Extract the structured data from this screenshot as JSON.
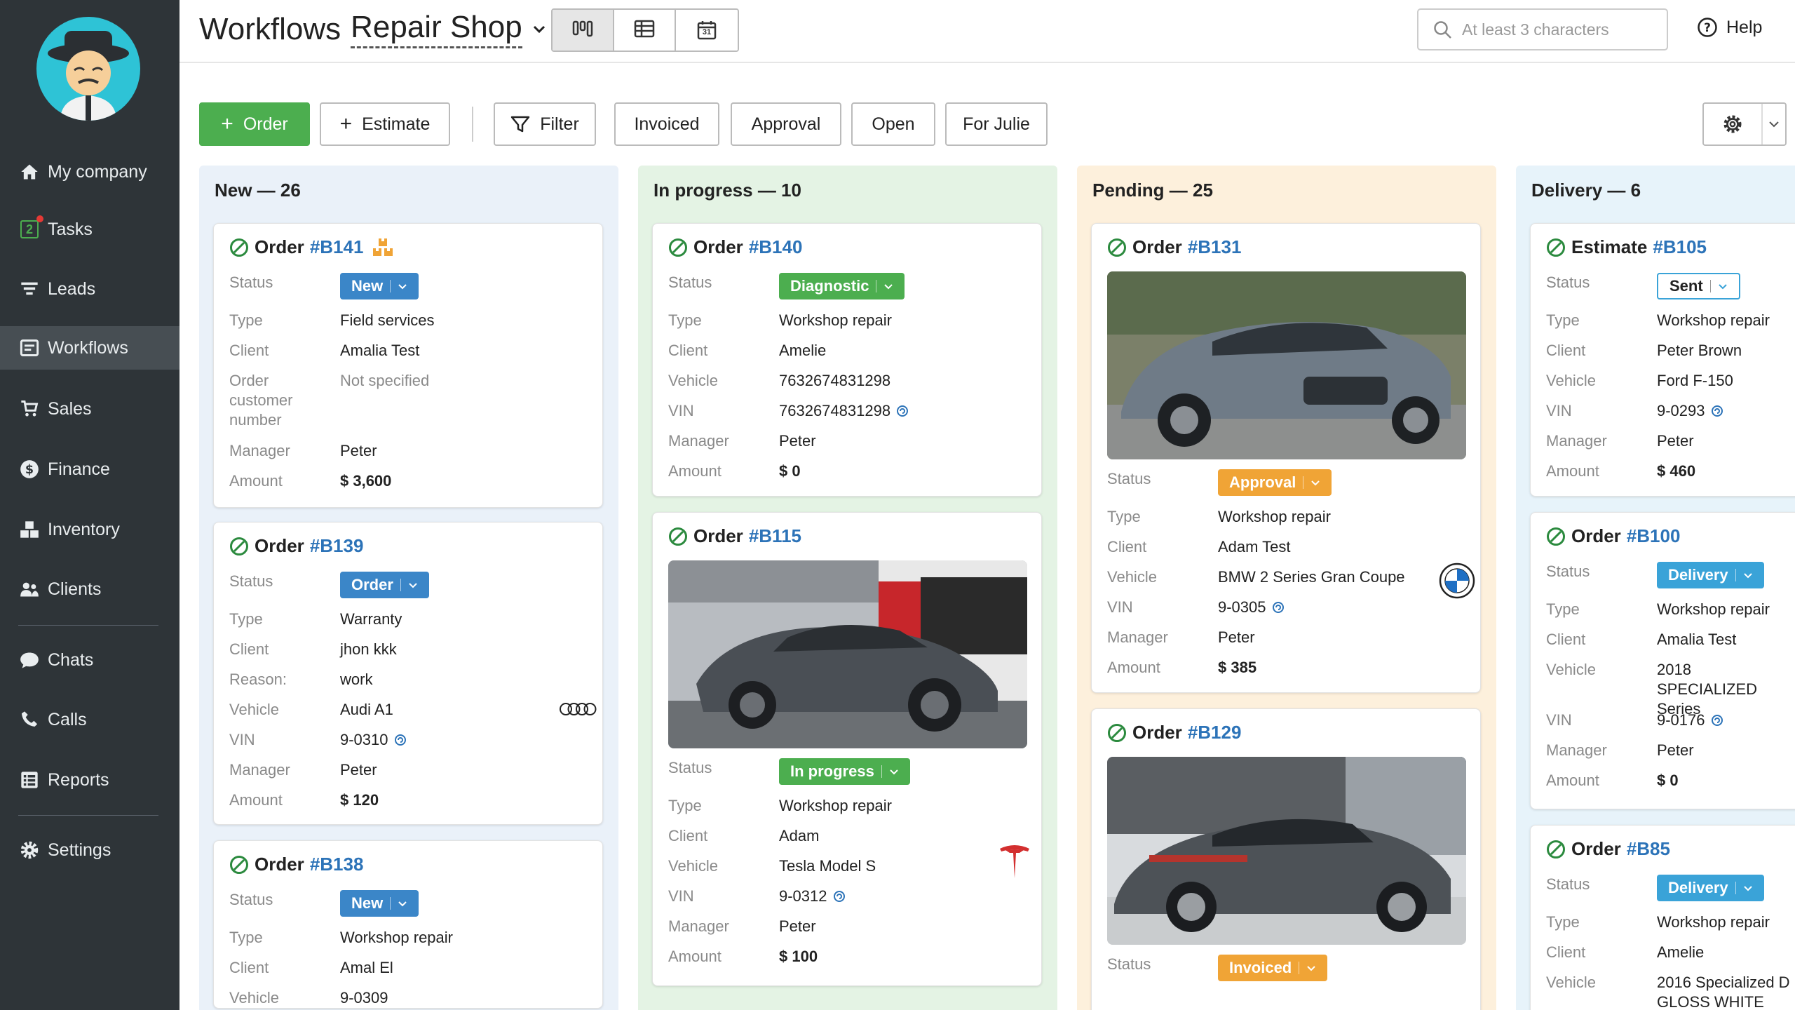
{
  "sidebar": {
    "items": [
      {
        "label": "My company",
        "icon": "home-icon"
      },
      {
        "label": "Tasks",
        "icon": "tasks-icon",
        "badge": "2"
      },
      {
        "label": "Leads",
        "icon": "funnel-icon"
      },
      {
        "label": "Workflows",
        "icon": "workflows-icon"
      },
      {
        "label": "Sales",
        "icon": "cart-icon"
      },
      {
        "label": "Finance",
        "icon": "dollar-icon"
      },
      {
        "label": "Inventory",
        "icon": "boxes-icon"
      },
      {
        "label": "Clients",
        "icon": "users-icon"
      },
      {
        "label": "Chats",
        "icon": "chat-icon"
      },
      {
        "label": "Calls",
        "icon": "phone-icon"
      },
      {
        "label": "Reports",
        "icon": "reports-icon"
      },
      {
        "label": "Settings",
        "icon": "gear-icon"
      }
    ],
    "active": "Workflows"
  },
  "header": {
    "title": "Workflows",
    "shop": "Repair Shop",
    "search_placeholder": "At least 3 characters",
    "help": "Help",
    "calendar_day": "31"
  },
  "toolbar": {
    "order": "Order",
    "estimate": "Estimate",
    "filter": "Filter",
    "invoiced": "Invoiced",
    "approval": "Approval",
    "open": "Open",
    "for_julie": "For Julie"
  },
  "colors": {
    "green": "#4cae4f",
    "blue": "#3b86c8",
    "orange": "#f0a436",
    "teal": "#3aa3d8",
    "link": "#2c73b8"
  },
  "columns": [
    {
      "title": "New — 26",
      "cards": [
        {
          "kind": "Order",
          "number": "#B141",
          "status": "New",
          "rows": [
            [
              "Type",
              "Field services"
            ],
            [
              "Client",
              "Amalia Test"
            ],
            [
              "Order customer number",
              "Not specified"
            ],
            [
              "Manager",
              "Peter"
            ],
            [
              "Amount",
              "$ 3,600"
            ]
          ]
        },
        {
          "kind": "Order",
          "number": "#B139",
          "status": "Order",
          "rows": [
            [
              "Type",
              "Warranty"
            ],
            [
              "Client",
              "jhon kkk"
            ],
            [
              "Reason:",
              "work"
            ],
            [
              "Vehicle",
              "Audi A1"
            ],
            [
              "VIN",
              "9-0310"
            ],
            [
              "Manager",
              "Peter"
            ],
            [
              "Amount",
              "$ 120"
            ]
          ]
        },
        {
          "kind": "Order",
          "number": "#B138",
          "status": "New",
          "rows": [
            [
              "Type",
              "Workshop repair"
            ],
            [
              "Client",
              "Amal El"
            ],
            [
              "Vehicle",
              "9-0309"
            ]
          ]
        }
      ]
    },
    {
      "title": "In progress — 10",
      "cards": [
        {
          "kind": "Order",
          "number": "#B140",
          "status": "Diagnostic",
          "rows": [
            [
              "Type",
              "Workshop repair"
            ],
            [
              "Client",
              "Amelie"
            ],
            [
              "Vehicle",
              "7632674831298"
            ],
            [
              "VIN",
              "7632674831298"
            ],
            [
              "Manager",
              "Peter"
            ],
            [
              "Amount",
              "$ 0"
            ]
          ]
        },
        {
          "kind": "Order",
          "number": "#B115",
          "status": "In progress",
          "rows": [
            [
              "Type",
              "Workshop repair"
            ],
            [
              "Client",
              "Adam"
            ],
            [
              "Vehicle",
              "Tesla Model S"
            ],
            [
              "VIN",
              "9-0312"
            ],
            [
              "Manager",
              "Peter"
            ],
            [
              "Amount",
              "$ 100"
            ]
          ]
        }
      ]
    },
    {
      "title": "Pending — 25",
      "cards": [
        {
          "kind": "Order",
          "number": "#B131",
          "status": "Approval",
          "rows": [
            [
              "Type",
              "Workshop repair"
            ],
            [
              "Client",
              "Adam Test"
            ],
            [
              "Vehicle",
              "BMW 2 Series Gran Coupe"
            ],
            [
              "VIN",
              "9-0305"
            ],
            [
              "Manager",
              "Peter"
            ],
            [
              "Amount",
              "$ 385"
            ]
          ]
        },
        {
          "kind": "Order",
          "number": "#B129",
          "status": "Invoiced",
          "rows": []
        }
      ]
    },
    {
      "title": "Delivery — 6",
      "cards": [
        {
          "kind": "Estimate",
          "number": "#B105",
          "status": "Sent",
          "rows": [
            [
              "Type",
              "Workshop repair"
            ],
            [
              "Client",
              "Peter Brown"
            ],
            [
              "Vehicle",
              "Ford F-150"
            ],
            [
              "VIN",
              "9-0293"
            ],
            [
              "Manager",
              "Peter"
            ],
            [
              "Amount",
              "$ 460"
            ]
          ]
        },
        {
          "kind": "Order",
          "number": "#B100",
          "status": "Delivery",
          "rows": [
            [
              "Type",
              "Workshop repair"
            ],
            [
              "Client",
              "Amalia Test"
            ],
            [
              "Vehicle",
              "2018 SPECIALIZED Series"
            ],
            [
              "VIN",
              "9-0176"
            ],
            [
              "Manager",
              "Peter"
            ],
            [
              "Amount",
              "$ 0"
            ]
          ]
        },
        {
          "kind": "Order",
          "number": "#B85",
          "status": "Delivery",
          "rows": [
            [
              "Type",
              "Workshop repair"
            ],
            [
              "Client",
              "Amelie"
            ],
            [
              "Vehicle",
              "2016 Specialized D GLOSS WHITE"
            ]
          ]
        }
      ]
    }
  ]
}
